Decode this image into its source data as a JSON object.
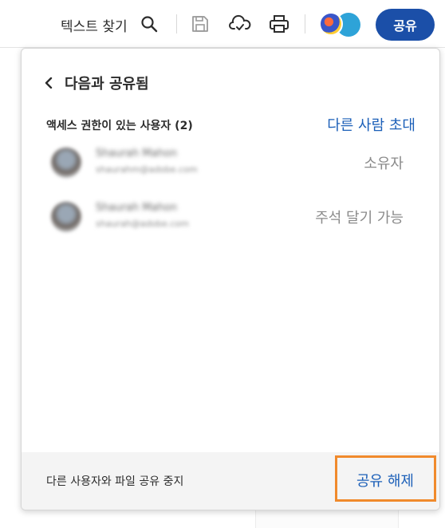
{
  "toolbar": {
    "find_text_label": "텍스트 찾기",
    "search_icon": "search-icon",
    "save_icon": "save-icon",
    "cloud_icon": "cloud-sync-icon",
    "print_icon": "print-icon",
    "share_button": "공유",
    "accent_color": "#1b4fa8"
  },
  "share_panel": {
    "title": "다음과 공유됨",
    "access_label": "액세스 권한이 있는 사용자 (2)",
    "invite_link": "다른 사람 초대",
    "users": [
      {
        "name": "Shaurah Mahon",
        "email": "shaurahm@adobe.com",
        "role": "소유자"
      },
      {
        "name": "Shaurah Mahon",
        "email": "shaurah@adobe.com",
        "role": "주석 달기 가능"
      }
    ],
    "footer": {
      "stop_sharing_label": "다른 사용자와 파일 공유 중지",
      "unshare_button": "공유 해제",
      "highlight_color": "#f08a2c"
    }
  }
}
